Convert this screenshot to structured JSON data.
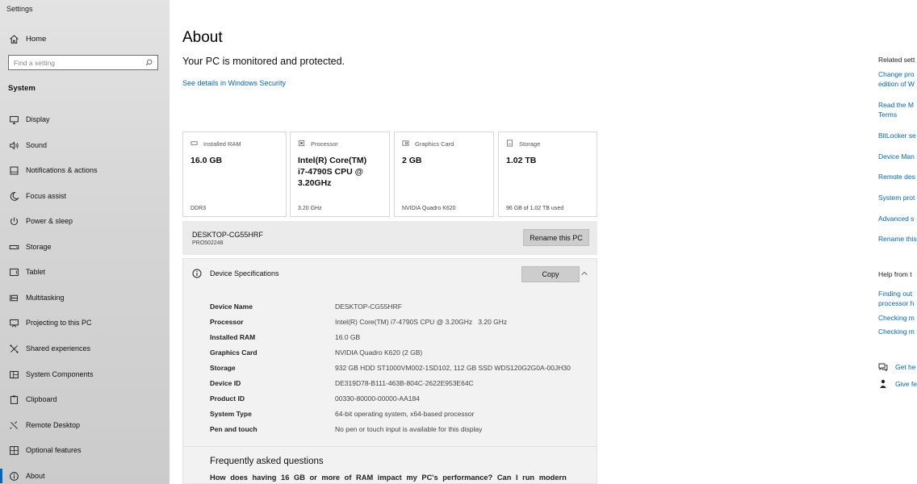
{
  "window": {
    "title": "Settings"
  },
  "sidebar": {
    "home_label": "Home",
    "search_placeholder": "Find a setting",
    "section_label": "System",
    "items": [
      {
        "label": "Display",
        "icon": "display-icon"
      },
      {
        "label": "Sound",
        "icon": "sound-icon"
      },
      {
        "label": "Notifications & actions",
        "icon": "notifications-icon"
      },
      {
        "label": "Focus assist",
        "icon": "focus-assist-icon"
      },
      {
        "label": "Power & sleep",
        "icon": "power-icon"
      },
      {
        "label": "Storage",
        "icon": "storage-icon"
      },
      {
        "label": "Tablet",
        "icon": "tablet-icon"
      },
      {
        "label": "Multitasking",
        "icon": "multitasking-icon"
      },
      {
        "label": "Projecting to this PC",
        "icon": "projecting-icon"
      },
      {
        "label": "Shared experiences",
        "icon": "shared-experiences-icon"
      },
      {
        "label": "System Components",
        "icon": "system-components-icon"
      },
      {
        "label": "Clipboard",
        "icon": "clipboard-icon"
      },
      {
        "label": "Remote Desktop",
        "icon": "remote-desktop-icon"
      },
      {
        "label": "Optional features",
        "icon": "optional-features-icon"
      },
      {
        "label": "About",
        "icon": "about-icon",
        "active": true
      }
    ]
  },
  "main": {
    "title": "About",
    "protection_status": "Your PC is monitored and protected.",
    "security_link": "See details in Windows Security",
    "cards": [
      {
        "label": "Installed RAM",
        "value": "16.0 GB",
        "sub": "DDR3",
        "icon": "ram-icon"
      },
      {
        "label": "Processor",
        "value": "Intel(R) Core(TM) i7-4790S CPU @ 3.20GHz",
        "sub": "3.20 GHz",
        "icon": "processor-icon"
      },
      {
        "label": "Graphics Card",
        "value": "2 GB",
        "sub": "NVIDIA Quadro K620",
        "icon": "graphics-card-icon"
      },
      {
        "label": "Storage",
        "value": "1.02 TB",
        "sub": "96 GB of 1.02 TB used",
        "icon": "storage-card-icon"
      }
    ],
    "pc": {
      "name": "DESKTOP-CG55HRF",
      "model": "PRO502248",
      "rename_button": "Rename this PC"
    },
    "specs": {
      "title": "Device Specifications",
      "copy_button": "Copy",
      "rows": [
        {
          "key": "Device Name",
          "value": "DESKTOP-CG55HRF"
        },
        {
          "key": "Processor",
          "value": "Intel(R) Core(TM) i7-4790S CPU @ 3.20GHz   3.20 GHz"
        },
        {
          "key": "Installed RAM",
          "value": "16.0 GB"
        },
        {
          "key": "Graphics Card",
          "value": "NVIDIA Quadro K620 (2 GB)"
        },
        {
          "key": "Storage",
          "value": "932 GB HDD ST1000VM002-1SD102, 112 GB SSD WDS120G2G0A-00JH30"
        },
        {
          "key": "Device ID",
          "value": "DE319D78-B111-463B-804C-2622E953E64C"
        },
        {
          "key": "Product ID",
          "value": "00330-80000-00000-AA184"
        },
        {
          "key": "System Type",
          "value": "64-bit operating system, x64-based processor"
        },
        {
          "key": "Pen and touch",
          "value": "No pen or touch input is available for this display"
        }
      ]
    },
    "faq": {
      "title": "Frequently asked questions",
      "question": "How does having 16 GB or more of RAM impact my PC's performance? Can I run modern"
    }
  },
  "right_panel": {
    "related_heading": "Related sett",
    "related_links": [
      "Change pro",
      "edition of W",
      "Read the M",
      "Terms",
      "BitLocker se",
      "Device Man",
      "Remote des",
      "System prot",
      "Advanced s",
      "Rename this"
    ],
    "help_heading": "Help from t",
    "help_links": [
      "Finding out",
      "processor h",
      "Checking m",
      "Checking m"
    ],
    "get_help": "Get he",
    "give_feedback": "Give fe"
  },
  "colors": {
    "accent": "#0067c0",
    "sidebar_bg": "#d9d9d9",
    "card_border": "#d8d8d8"
  }
}
